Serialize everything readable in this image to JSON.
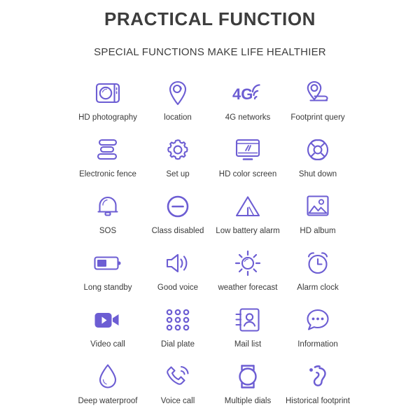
{
  "header": {
    "title": "PRACTICAL FUNCTION",
    "subtitle": "SPECIAL FUNCTIONS MAKE LIFE HEALTHIER"
  },
  "colors": {
    "accent": "#6C5DD3",
    "accent_light": "#7A6BE0",
    "text": "#3a3a3a",
    "title": "#3d3d3d",
    "background": "#ffffff"
  },
  "features": [
    {
      "label": "HD photography",
      "icon": "camera-icon"
    },
    {
      "label": "location",
      "icon": "map-pin-icon"
    },
    {
      "label": "4G networks",
      "icon": "4g-signal-icon",
      "badge": "4G"
    },
    {
      "label": "Footprint query",
      "icon": "footprint-query-icon"
    },
    {
      "label": "Electronic fence",
      "icon": "fence-bars-icon"
    },
    {
      "label": "Set up",
      "icon": "gear-icon"
    },
    {
      "label": "HD color screen",
      "icon": "monitor-icon"
    },
    {
      "label": "Shut down",
      "icon": "lifebuoy-power-icon"
    },
    {
      "label": "SOS",
      "icon": "bell-icon"
    },
    {
      "label": "Class disabled",
      "icon": "minus-circle-icon"
    },
    {
      "label": "Low battery alarm",
      "icon": "warning-triangle-icon"
    },
    {
      "label": "HD album",
      "icon": "photo-album-icon"
    },
    {
      "label": "Long standby",
      "icon": "battery-icon"
    },
    {
      "label": "Good voice",
      "icon": "speaker-icon"
    },
    {
      "label": "weather forecast",
      "icon": "sun-icon"
    },
    {
      "label": "Alarm clock",
      "icon": "alarm-clock-icon"
    },
    {
      "label": "Video call",
      "icon": "video-camera-icon"
    },
    {
      "label": "Dial plate",
      "icon": "dial-pad-icon"
    },
    {
      "label": "Mail list",
      "icon": "contact-book-icon"
    },
    {
      "label": "Information",
      "icon": "chat-bubble-icon"
    },
    {
      "label": "Deep waterproof",
      "icon": "water-drop-icon"
    },
    {
      "label": "Voice call",
      "icon": "phone-call-icon"
    },
    {
      "label": "Multiple dials",
      "icon": "watch-dial-icon"
    },
    {
      "label": "Historical footprint",
      "icon": "footprint-icon"
    }
  ]
}
